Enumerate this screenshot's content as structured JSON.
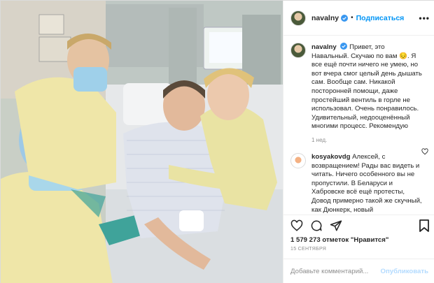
{
  "post": {
    "author": "navalny",
    "follow_label": "Подписаться",
    "separator": "•",
    "more_icon": "more-horizontal-icon",
    "caption": {
      "author": "navalny",
      "text": "Привет, это Навальный. Скучаю по вам 😔. Я все ещё почти ничего не умею, но вот вчера смог целый день дышать сам. Вообще сам. Никакой посторонней помощи, даже простейший вентиль в горле не использовал. Очень понравилось. Удивительный, недооценённый многими процесс. Рекомендую",
      "age": "1 нед."
    },
    "comment": {
      "author": "kosyakovdg",
      "text": "Алексей, с возвращением! Рады вас видеть и читать. Ничего особенного вы не пропустили. В Беларуси и Хабровске всё ещё протесты, Довод примерно такой же скучный, как Дюнкерк, новый"
    },
    "likes": "1 579 273 отметок \"Нравится\"",
    "date": "15 СЕНТЯБРЯ",
    "add_comment_placeholder": "Добавьте комментарий...",
    "publish_label": "Опубликовать",
    "icons": [
      "heart-icon",
      "comment-icon",
      "share-icon",
      "bookmark-icon"
    ],
    "colors": {
      "link": "#0095f6",
      "verified": "#3897f0",
      "muted": "#8e8e8e",
      "publish_disabled": "#b3dbff"
    }
  }
}
